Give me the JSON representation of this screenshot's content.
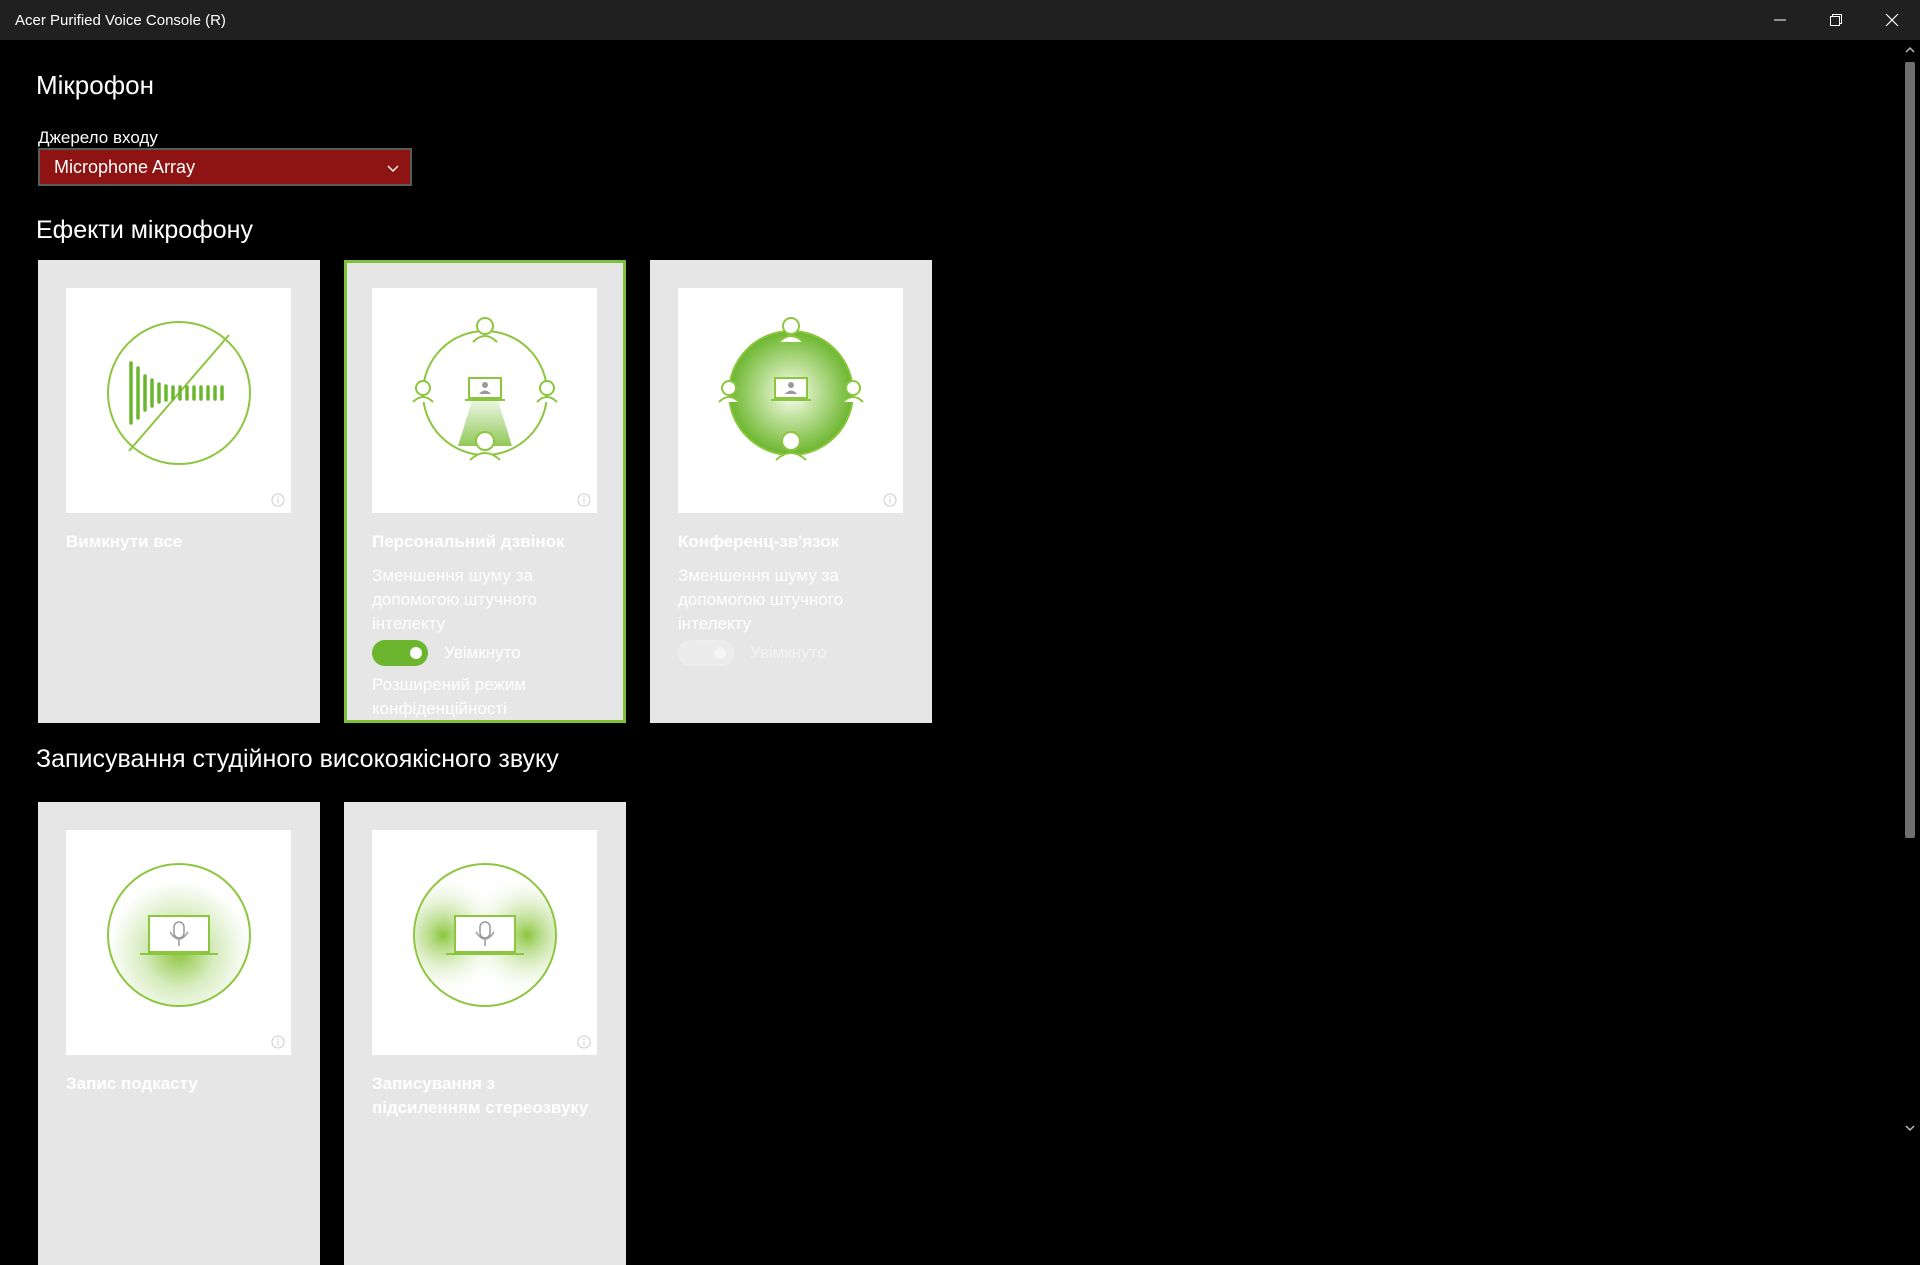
{
  "window": {
    "title": "Acer Purified Voice Console (R)"
  },
  "page": {
    "title": "Мікрофон"
  },
  "input_source": {
    "label": "Джерело входу",
    "selected": "Microphone Array"
  },
  "effects": {
    "heading": "Ефекти мікрофону",
    "cards": [
      {
        "name": "Вимкнути все",
        "icon": "mute-waveform-icon",
        "selected": false
      },
      {
        "name": "Персональний дзвінок",
        "icon": "personal-call-icon",
        "selected": true,
        "description": "Зменшення шуму за допомогою штучного інтелекту",
        "toggle_label": "Увімкнуто",
        "toggle_on": true,
        "extra": "Розширений режим конфіденційності"
      },
      {
        "name": "Конференц-зв'язок",
        "icon": "conference-call-icon",
        "selected": false,
        "description": "Зменшення шуму за допомогою штучного інтелекту",
        "toggle_label": "Увімкнуто",
        "toggle_on": false
      }
    ]
  },
  "studio": {
    "heading": "Записування студійного високоякісного звуку",
    "cards": [
      {
        "name": "Запис подкасту",
        "icon": "podcast-mic-icon"
      },
      {
        "name": "Записування з підсиленням стереозвуку",
        "icon": "stereo-mic-icon"
      }
    ]
  },
  "colors": {
    "accent_green": "#7ec03a",
    "dropdown_red": "#8e1414",
    "card_bg": "#e6e6e6"
  }
}
